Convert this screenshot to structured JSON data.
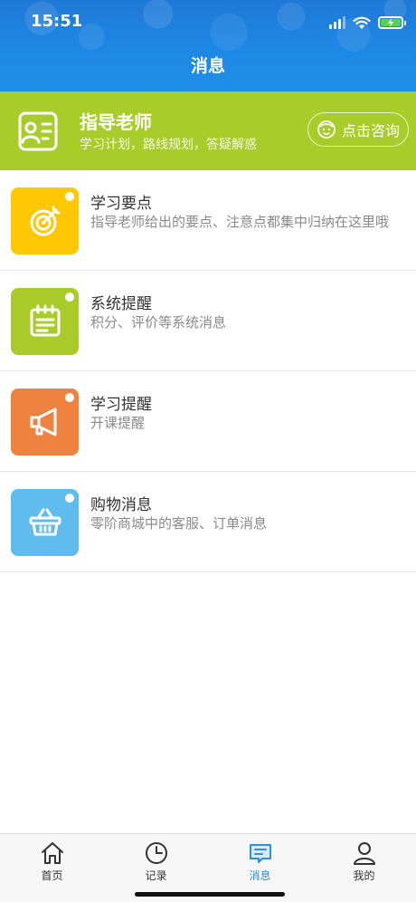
{
  "status": {
    "time": "15:51"
  },
  "header": {
    "title": "消息"
  },
  "mentor": {
    "title": "指导老师",
    "subtitle": "学习计划，路线规划，答疑解惑",
    "consult_label": "点击咨询"
  },
  "messages": [
    {
      "title": "学习要点",
      "desc": "指导老师给出的要点、注意点都集中归纳在这里哦",
      "icon": "target-icon",
      "color": "#ffc803"
    },
    {
      "title": "系统提醒",
      "desc": "积分、评价等系统消息",
      "icon": "notepad-icon",
      "color": "#a9cc2b"
    },
    {
      "title": "学习提醒",
      "desc": "开课提醒",
      "icon": "megaphone-icon",
      "color": "#f0823f"
    },
    {
      "title": "购物消息",
      "desc": "零阶商城中的客服、订单消息",
      "icon": "basket-icon",
      "color": "#5fbcec"
    }
  ],
  "tabs": [
    {
      "label": "首页",
      "icon": "home-icon"
    },
    {
      "label": "记录",
      "icon": "clock-icon"
    },
    {
      "label": "消息",
      "icon": "message-icon",
      "active": true
    },
    {
      "label": "我的",
      "icon": "profile-icon"
    }
  ],
  "colors": {
    "header_blue": "#1e88e5",
    "mentor_green": "#a8cd2a",
    "active_tab": "#2b90e0"
  }
}
